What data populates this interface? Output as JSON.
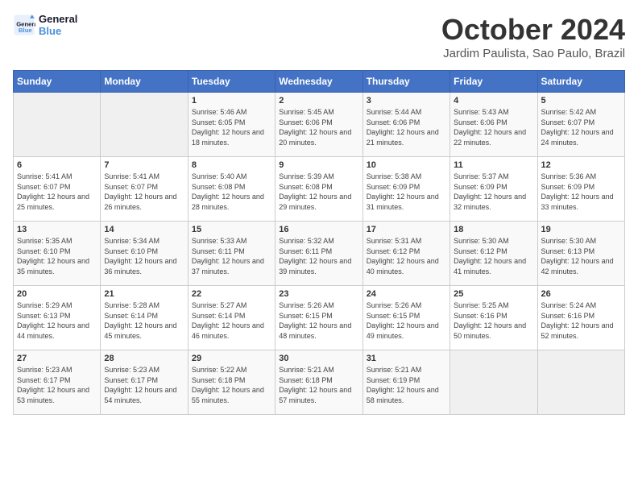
{
  "logo": {
    "line1": "General",
    "line2": "Blue"
  },
  "title": "October 2024",
  "subtitle": "Jardim Paulista, Sao Paulo, Brazil",
  "days_of_week": [
    "Sunday",
    "Monday",
    "Tuesday",
    "Wednesday",
    "Thursday",
    "Friday",
    "Saturday"
  ],
  "weeks": [
    [
      {
        "day": "",
        "info": ""
      },
      {
        "day": "",
        "info": ""
      },
      {
        "day": "1",
        "info": "Sunrise: 5:46 AM\nSunset: 6:05 PM\nDaylight: 12 hours and 18 minutes."
      },
      {
        "day": "2",
        "info": "Sunrise: 5:45 AM\nSunset: 6:06 PM\nDaylight: 12 hours and 20 minutes."
      },
      {
        "day": "3",
        "info": "Sunrise: 5:44 AM\nSunset: 6:06 PM\nDaylight: 12 hours and 21 minutes."
      },
      {
        "day": "4",
        "info": "Sunrise: 5:43 AM\nSunset: 6:06 PM\nDaylight: 12 hours and 22 minutes."
      },
      {
        "day": "5",
        "info": "Sunrise: 5:42 AM\nSunset: 6:07 PM\nDaylight: 12 hours and 24 minutes."
      }
    ],
    [
      {
        "day": "6",
        "info": "Sunrise: 5:41 AM\nSunset: 6:07 PM\nDaylight: 12 hours and 25 minutes."
      },
      {
        "day": "7",
        "info": "Sunrise: 5:41 AM\nSunset: 6:07 PM\nDaylight: 12 hours and 26 minutes."
      },
      {
        "day": "8",
        "info": "Sunrise: 5:40 AM\nSunset: 6:08 PM\nDaylight: 12 hours and 28 minutes."
      },
      {
        "day": "9",
        "info": "Sunrise: 5:39 AM\nSunset: 6:08 PM\nDaylight: 12 hours and 29 minutes."
      },
      {
        "day": "10",
        "info": "Sunrise: 5:38 AM\nSunset: 6:09 PM\nDaylight: 12 hours and 31 minutes."
      },
      {
        "day": "11",
        "info": "Sunrise: 5:37 AM\nSunset: 6:09 PM\nDaylight: 12 hours and 32 minutes."
      },
      {
        "day": "12",
        "info": "Sunrise: 5:36 AM\nSunset: 6:09 PM\nDaylight: 12 hours and 33 minutes."
      }
    ],
    [
      {
        "day": "13",
        "info": "Sunrise: 5:35 AM\nSunset: 6:10 PM\nDaylight: 12 hours and 35 minutes."
      },
      {
        "day": "14",
        "info": "Sunrise: 5:34 AM\nSunset: 6:10 PM\nDaylight: 12 hours and 36 minutes."
      },
      {
        "day": "15",
        "info": "Sunrise: 5:33 AM\nSunset: 6:11 PM\nDaylight: 12 hours and 37 minutes."
      },
      {
        "day": "16",
        "info": "Sunrise: 5:32 AM\nSunset: 6:11 PM\nDaylight: 12 hours and 39 minutes."
      },
      {
        "day": "17",
        "info": "Sunrise: 5:31 AM\nSunset: 6:12 PM\nDaylight: 12 hours and 40 minutes."
      },
      {
        "day": "18",
        "info": "Sunrise: 5:30 AM\nSunset: 6:12 PM\nDaylight: 12 hours and 41 minutes."
      },
      {
        "day": "19",
        "info": "Sunrise: 5:30 AM\nSunset: 6:13 PM\nDaylight: 12 hours and 42 minutes."
      }
    ],
    [
      {
        "day": "20",
        "info": "Sunrise: 5:29 AM\nSunset: 6:13 PM\nDaylight: 12 hours and 44 minutes."
      },
      {
        "day": "21",
        "info": "Sunrise: 5:28 AM\nSunset: 6:14 PM\nDaylight: 12 hours and 45 minutes."
      },
      {
        "day": "22",
        "info": "Sunrise: 5:27 AM\nSunset: 6:14 PM\nDaylight: 12 hours and 46 minutes."
      },
      {
        "day": "23",
        "info": "Sunrise: 5:26 AM\nSunset: 6:15 PM\nDaylight: 12 hours and 48 minutes."
      },
      {
        "day": "24",
        "info": "Sunrise: 5:26 AM\nSunset: 6:15 PM\nDaylight: 12 hours and 49 minutes."
      },
      {
        "day": "25",
        "info": "Sunrise: 5:25 AM\nSunset: 6:16 PM\nDaylight: 12 hours and 50 minutes."
      },
      {
        "day": "26",
        "info": "Sunrise: 5:24 AM\nSunset: 6:16 PM\nDaylight: 12 hours and 52 minutes."
      }
    ],
    [
      {
        "day": "27",
        "info": "Sunrise: 5:23 AM\nSunset: 6:17 PM\nDaylight: 12 hours and 53 minutes."
      },
      {
        "day": "28",
        "info": "Sunrise: 5:23 AM\nSunset: 6:17 PM\nDaylight: 12 hours and 54 minutes."
      },
      {
        "day": "29",
        "info": "Sunrise: 5:22 AM\nSunset: 6:18 PM\nDaylight: 12 hours and 55 minutes."
      },
      {
        "day": "30",
        "info": "Sunrise: 5:21 AM\nSunset: 6:18 PM\nDaylight: 12 hours and 57 minutes."
      },
      {
        "day": "31",
        "info": "Sunrise: 5:21 AM\nSunset: 6:19 PM\nDaylight: 12 hours and 58 minutes."
      },
      {
        "day": "",
        "info": ""
      },
      {
        "day": "",
        "info": ""
      }
    ]
  ]
}
